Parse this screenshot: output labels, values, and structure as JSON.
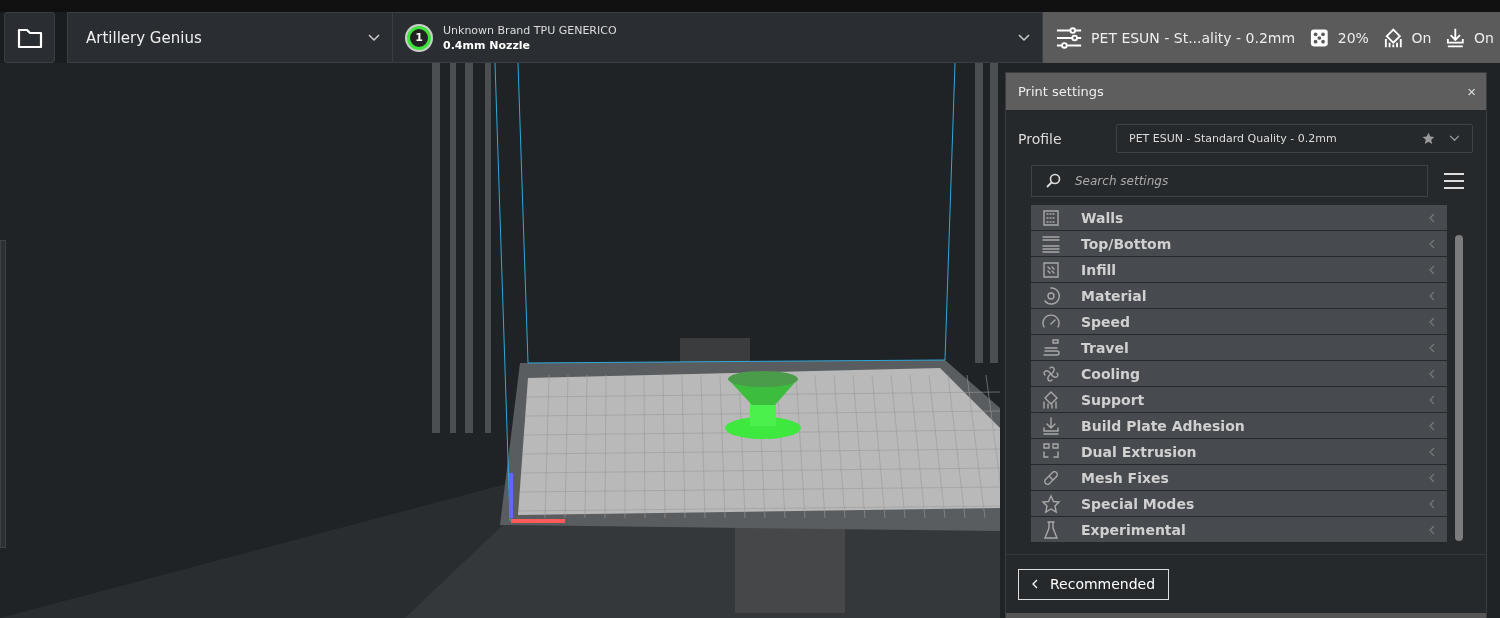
{
  "toolbar": {
    "printer": "Artillery Genius",
    "extruder": {
      "number": "1",
      "material": "Unknown Brand TPU GENERICO",
      "nozzle": "0.4mm Nozzle"
    },
    "print_setup": {
      "profile": "PET ESUN - St...ality - 0.2mm",
      "infill": "20%",
      "support": "On",
      "adhesion": "On"
    }
  },
  "print_settings": {
    "title": "Print settings",
    "close": "×",
    "profile_label": "Profile",
    "profile_value": "PET ESUN - Standard Quality - 0.2mm",
    "search_placeholder": "Search settings",
    "categories": [
      {
        "label": "Walls"
      },
      {
        "label": "Top/Bottom"
      },
      {
        "label": "Infill"
      },
      {
        "label": "Material"
      },
      {
        "label": "Speed"
      },
      {
        "label": "Travel"
      },
      {
        "label": "Cooling"
      },
      {
        "label": "Support"
      },
      {
        "label": "Build Plate Adhesion"
      },
      {
        "label": "Dual Extrusion"
      },
      {
        "label": "Mesh Fixes"
      },
      {
        "label": "Special Modes"
      },
      {
        "label": "Experimental"
      }
    ],
    "recommended_button": "Recommended"
  }
}
